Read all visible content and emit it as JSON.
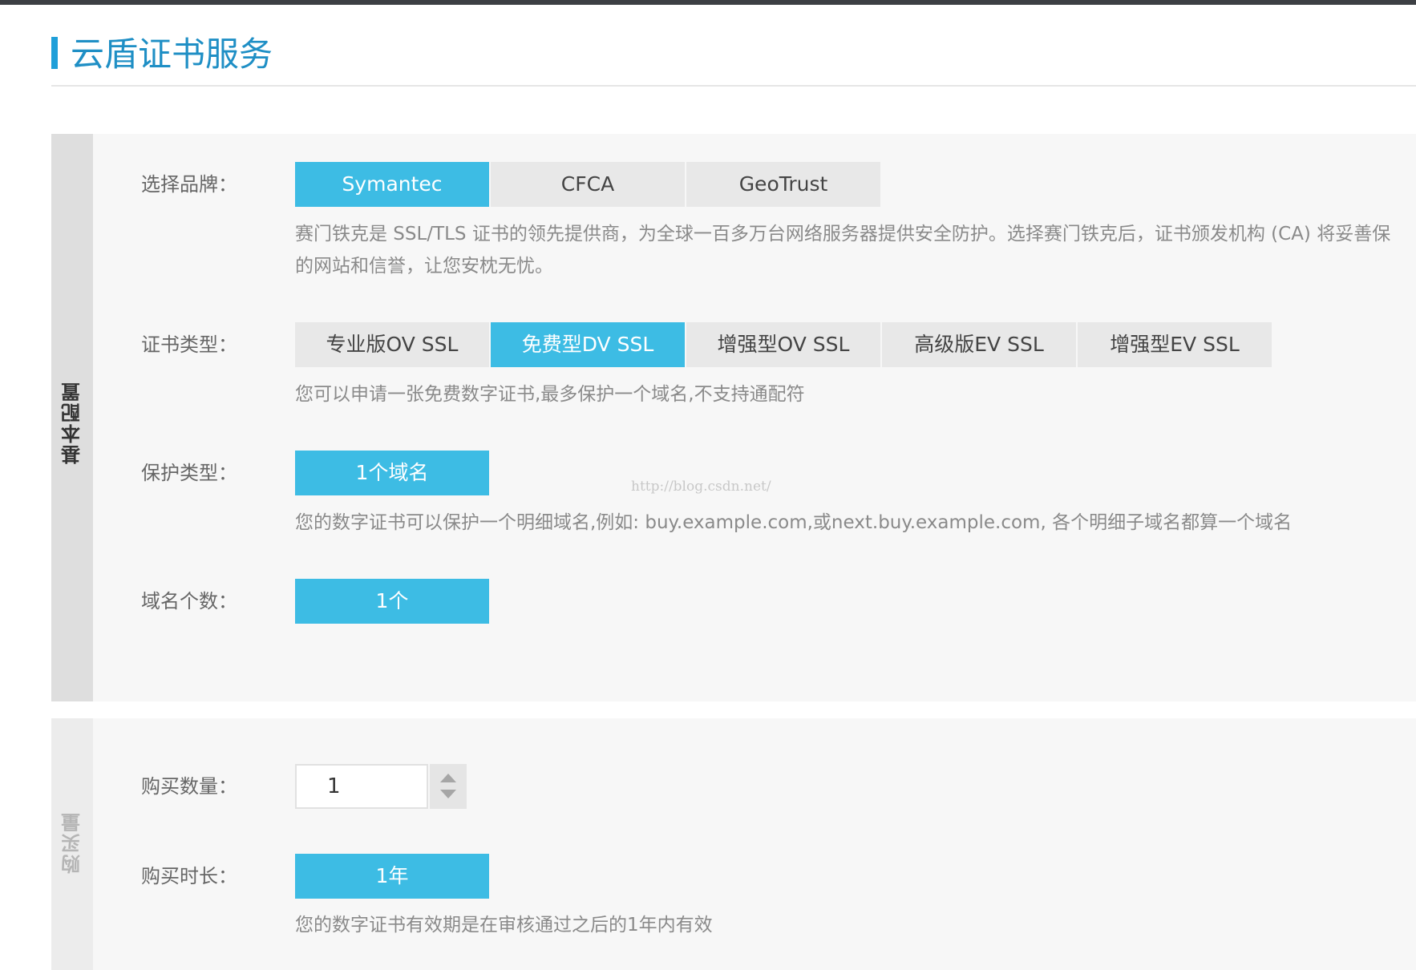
{
  "header": {
    "title": "云盾证书服务"
  },
  "basic_config": {
    "section_label": "基本配置",
    "brand": {
      "label": "选择品牌：",
      "options": [
        "Symantec",
        "CFCA",
        "GeoTrust"
      ],
      "selected": "Symantec",
      "description_line1": "赛门铁克是 SSL/TLS 证书的领先提供商，为全球一百多万台网络服务器提供安全防护。选择赛门铁克后，证书颁发机构 (CA) 将妥善保",
      "description_line2": "的网站和信誉，让您安枕无忧。"
    },
    "cert_type": {
      "label": "证书类型：",
      "options": [
        "专业版OV SSL",
        "免费型DV SSL",
        "增强型OV SSL",
        "高级版EV SSL",
        "增强型EV SSL"
      ],
      "selected": "免费型DV SSL",
      "description": "您可以申请一张免费数字证书,最多保护一个域名,不支持通配符"
    },
    "protect_type": {
      "label": "保护类型：",
      "options": [
        "1个域名"
      ],
      "selected": "1个域名",
      "description": "您的数字证书可以保护一个明细域名,例如: buy.example.com,或next.buy.example.com, 各个明细子域名都算一个域名"
    },
    "domain_count": {
      "label": "域名个数：",
      "options": [
        "1个"
      ],
      "selected": "1个"
    },
    "watermark": "http://blog.csdn.net/"
  },
  "purchase": {
    "section_label": "购买量",
    "quantity": {
      "label": "购买数量：",
      "value": "1"
    },
    "duration": {
      "label": "购买时长：",
      "options": [
        "1年"
      ],
      "selected": "1年",
      "description": "您的数字证书有效期是在审核通过之后的1年内有效"
    }
  },
  "colors": {
    "accent": "#3dbce4",
    "title": "#1f8fc5",
    "topbar": "#3c3f44"
  }
}
